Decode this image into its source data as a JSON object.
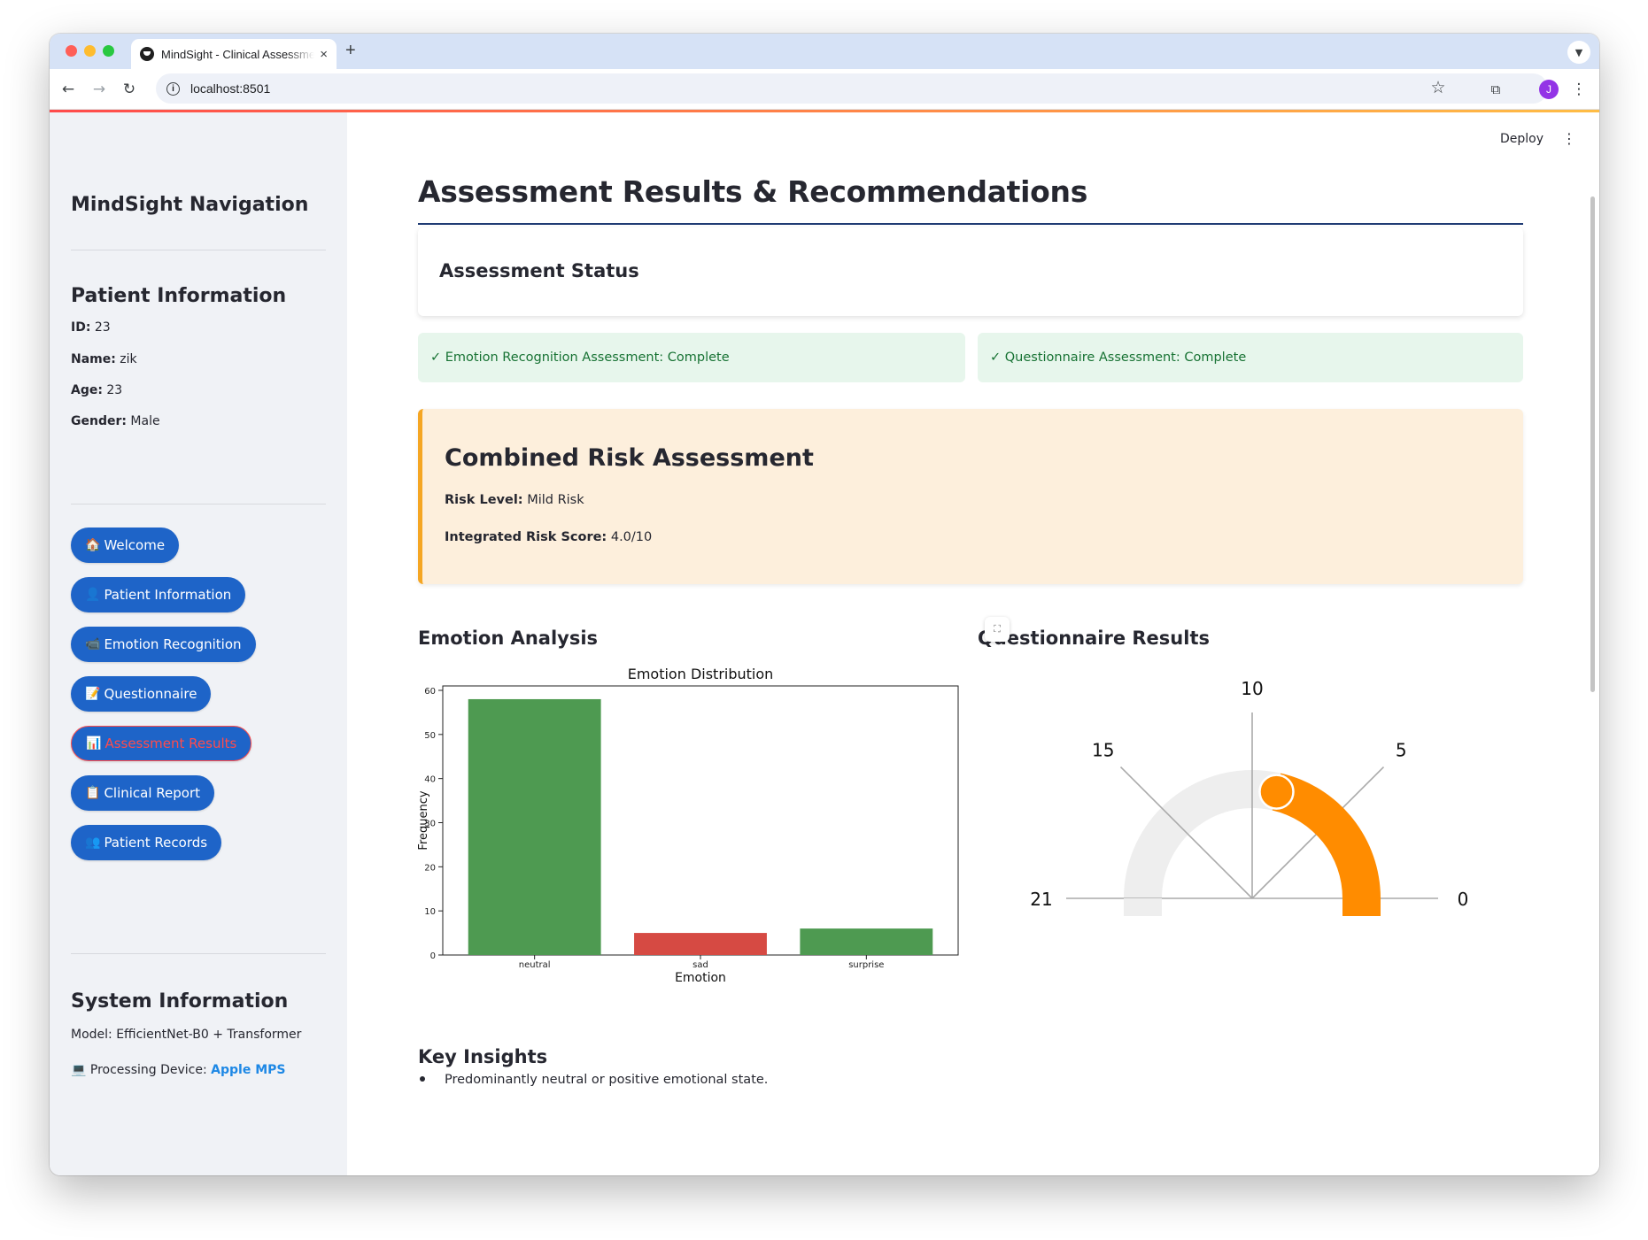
{
  "browser": {
    "tab_title": "MindSight - Clinical Assessment",
    "tab_close": "×",
    "new_tab": "+",
    "url": "localhost:8501",
    "profile_initial": "J"
  },
  "sidebar": {
    "nav_title": "MindSight Navigation",
    "patient_title": "Patient Information",
    "patient": [
      {
        "label": "ID:",
        "value": " 23"
      },
      {
        "label": "Name:",
        "value": " zik"
      },
      {
        "label": "Age:",
        "value": " 23"
      },
      {
        "label": "Gender:",
        "value": " Male"
      }
    ],
    "nav_items": [
      {
        "icon": "🏠",
        "label": "Welcome",
        "active": false
      },
      {
        "icon": "👤",
        "label": "Patient Information",
        "active": false
      },
      {
        "icon": "📹",
        "label": "Emotion Recognition",
        "active": false
      },
      {
        "icon": "📝",
        "label": "Questionnaire",
        "active": false
      },
      {
        "icon": "📊",
        "label": "Assessment Results",
        "active": true
      },
      {
        "icon": "📋",
        "label": "Clinical Report",
        "active": false
      },
      {
        "icon": "👥",
        "label": "Patient Records",
        "active": false
      }
    ],
    "system_title": "System Information",
    "model_text": "Model: EfficientNet-B0 + Transformer",
    "device_icon": "💻",
    "device_label": " Processing Device: ",
    "device_value": "Apple MPS"
  },
  "header": {
    "deploy": "Deploy",
    "menu": "⋮"
  },
  "main": {
    "title": "Assessment Results & Recommendations",
    "status_title": "Assessment Status",
    "status_items": [
      "✓ Emotion Recognition Assessment: Complete",
      "✓ Questionnaire Assessment: Complete"
    ],
    "risk_title": "Combined Risk Assessment",
    "risk_level_label": "Risk Level:",
    "risk_level_value": " Mild Risk",
    "risk_score_label": "Integrated Risk Score:",
    "risk_score_value": " 4.0/10",
    "emotion_heading": "Emotion Analysis",
    "questionnaire_heading": "Questionnaire Results",
    "insights_heading": "Key Insights",
    "insights": [
      "Predominantly neutral or positive emotional state."
    ]
  },
  "chart_data": [
    {
      "type": "bar",
      "title": "Emotion Distribution",
      "xlabel": "Emotion",
      "ylabel": "Frequency",
      "categories": [
        "neutral",
        "sad",
        "surprise"
      ],
      "values": [
        58,
        5,
        6
      ],
      "colors": [
        "#4e9a51",
        "#d64a43",
        "#4e9a51"
      ],
      "ylim": [
        0,
        61
      ],
      "yticks": [
        0,
        10,
        20,
        30,
        40,
        50,
        60
      ]
    },
    {
      "type": "gauge",
      "title": "",
      "value": 9,
      "range": [
        0,
        21
      ],
      "tick_labels": [
        "0",
        "5",
        "10",
        "15",
        "21"
      ],
      "tick_values": [
        0,
        5.25,
        10.5,
        15.75,
        21
      ],
      "bar_color": "#ff8c00",
      "track_color": "#eeeeee"
    }
  ]
}
